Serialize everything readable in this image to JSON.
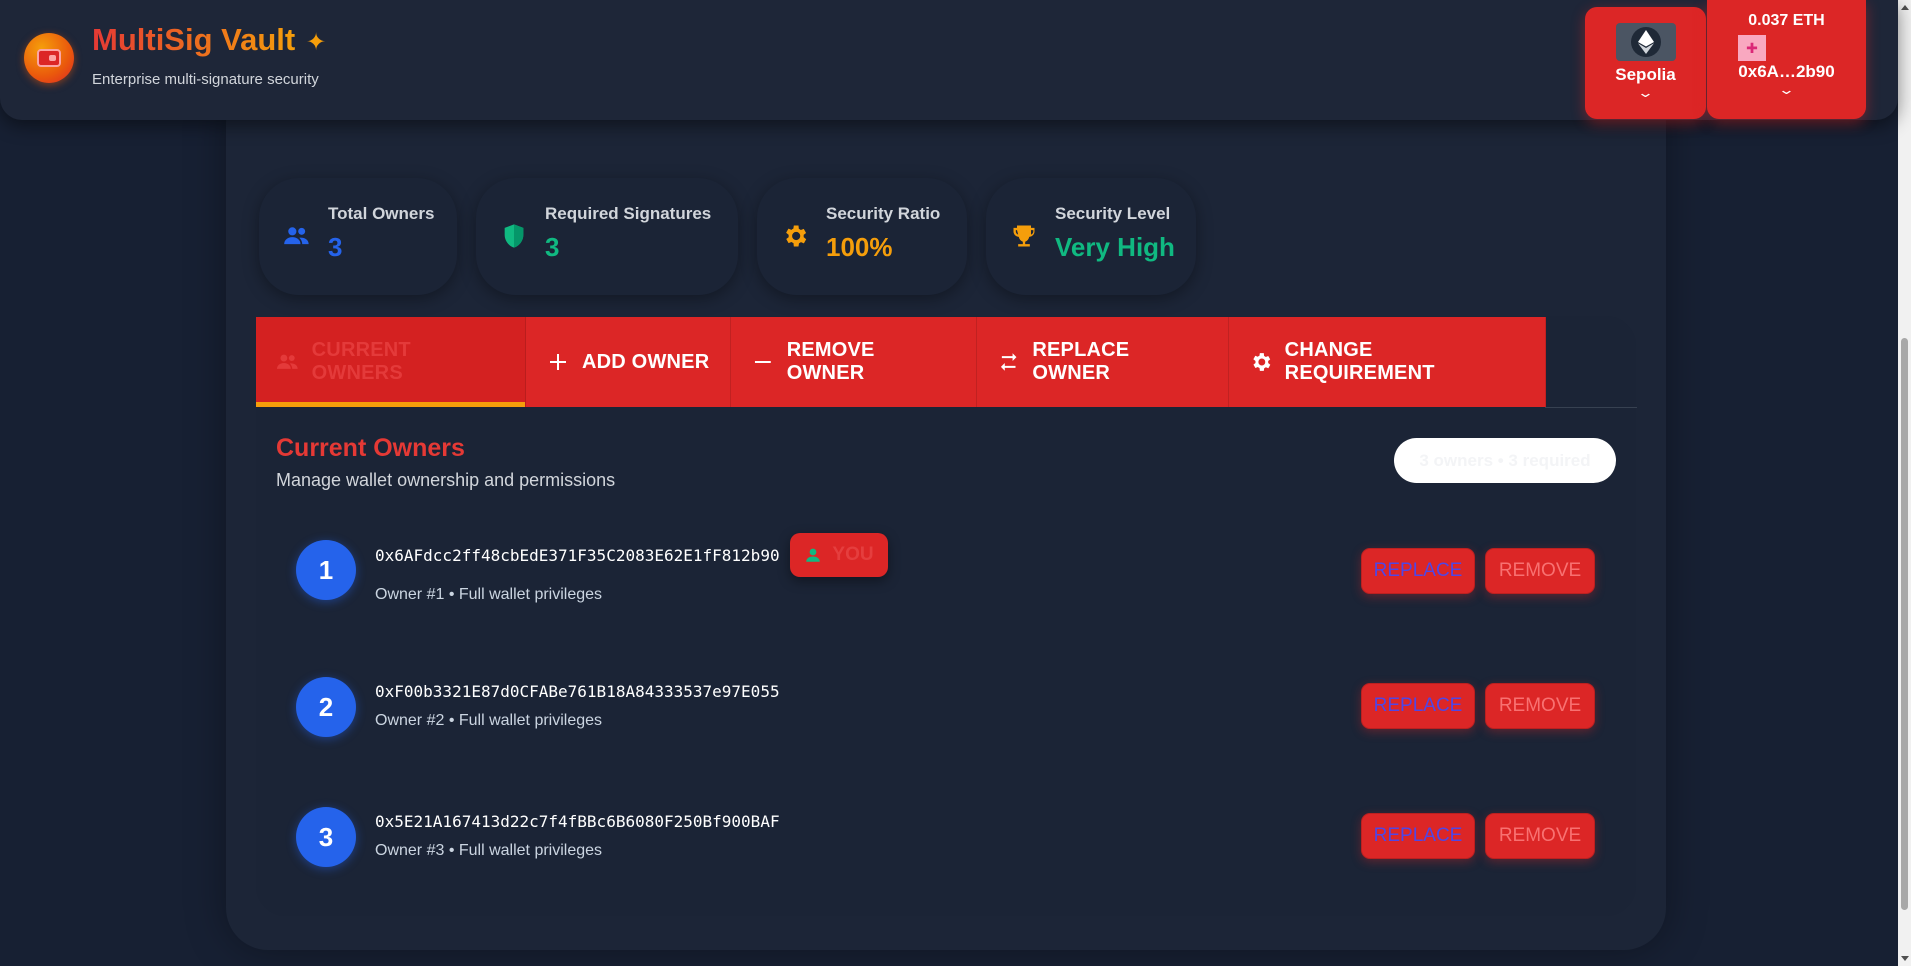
{
  "header": {
    "title": "MultiSig Vault",
    "subtitle": "Enterprise multi-signature security",
    "network": {
      "name": "Sepolia"
    },
    "account": {
      "balance": "0.037 ETH",
      "address": "0x6A…2b90"
    }
  },
  "stats": [
    {
      "label": "Total Owners",
      "value": "3",
      "color": "#2563eb",
      "icon": "people-icon"
    },
    {
      "label": "Required Signatures",
      "value": "3",
      "color": "#10b981",
      "icon": "shield-icon"
    },
    {
      "label": "Security Ratio",
      "value": "100%",
      "color": "#f59e0b",
      "icon": "gear-icon"
    },
    {
      "label": "Security Level",
      "value": "Very High",
      "color": "#10b981",
      "icon": "trophy-icon"
    }
  ],
  "tabs": [
    {
      "label": "CURRENT OWNERS",
      "active": true
    },
    {
      "label": "ADD OWNER"
    },
    {
      "label": "REMOVE OWNER"
    },
    {
      "label": "REPLACE OWNER"
    },
    {
      "label": "CHANGE REQUIREMENT"
    }
  ],
  "section": {
    "title": "Current Owners",
    "subtitle": "Manage wallet ownership and permissions",
    "count_badge": "3 owners • 3 required"
  },
  "owners": [
    {
      "number": "1",
      "address": "0x6AFdcc2ff48cbEdE371F35C2083E62E1fF812b90",
      "description": "Owner #1 • Full wallet privileges",
      "is_you": true,
      "you_label": "YOU",
      "replace_label": "REPLACE",
      "remove_label": "REMOVE"
    },
    {
      "number": "2",
      "address": "0xF00b3321E87d0CFABe761B18A84333537e97E055",
      "description": "Owner #2 • Full wallet privileges",
      "replace_label": "REPLACE",
      "remove_label": "REMOVE"
    },
    {
      "number": "3",
      "address": "0x5E21A167413d22c7f4fBBc6B6080F250Bf900BAF",
      "description": "Owner #3 • Full wallet privileges",
      "replace_label": "REPLACE",
      "remove_label": "REMOVE"
    }
  ],
  "colors": {
    "accent_red": "#dc2626",
    "accent_orange": "#f59e0b",
    "owner_blue": "#2563eb",
    "background": "#172033"
  }
}
